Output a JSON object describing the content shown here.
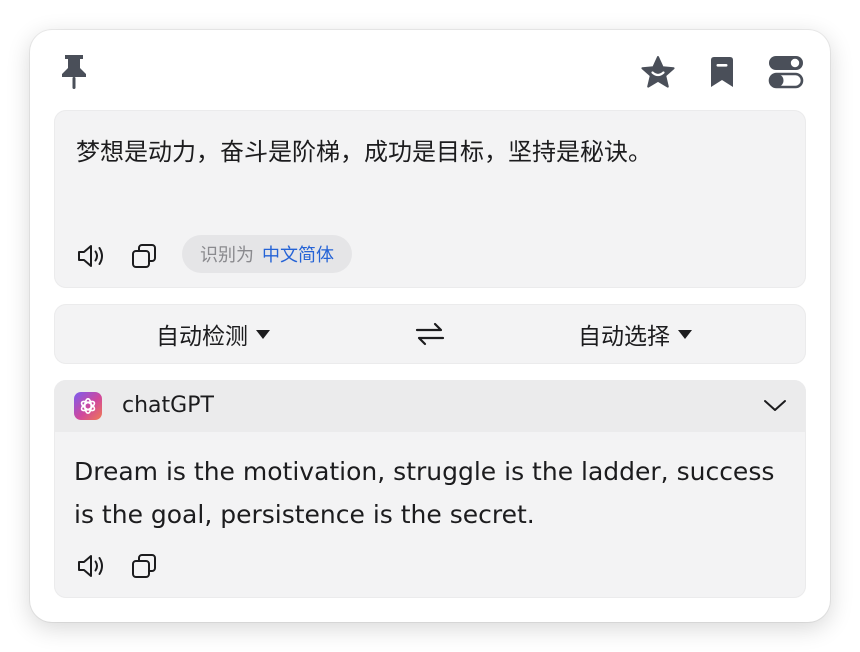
{
  "source": {
    "text": "梦想是动力，奋斗是阶梯，成功是目标，坚持是秘诀。",
    "detected_prefix": "识别为",
    "detected_language": "中文简体"
  },
  "language_bar": {
    "source_language": "自动检测",
    "target_language": "自动选择"
  },
  "result": {
    "engine_name": "chatGPT",
    "text": "Dream is the motivation, struggle is the ladder, success is the goal, persistence is the secret."
  },
  "icons": {
    "pin": "pin-icon",
    "star": "star-icon",
    "bookmark": "bookmark-icon",
    "toggle": "toggle-settings-icon",
    "speaker": "speaker-icon",
    "copy": "copy-icon",
    "swap": "swap-icon",
    "chevron": "chevron-down-icon",
    "engine_logo": "chatgpt-logo-icon"
  },
  "colors": {
    "accent": "#2563d6",
    "icon": "#4a4f59",
    "panel": "#f3f3f4"
  }
}
